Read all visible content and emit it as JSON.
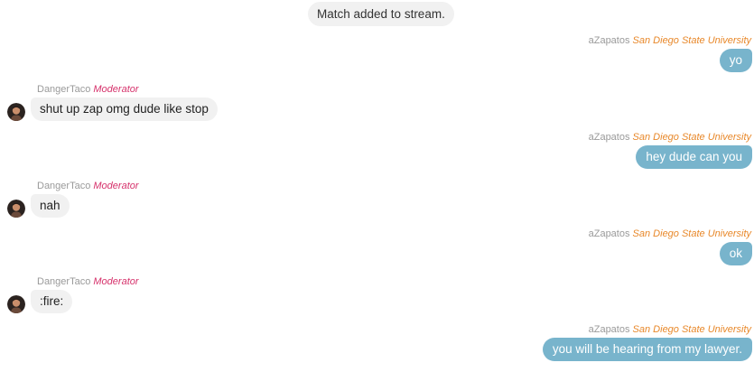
{
  "system_message": "Match added to stream.",
  "messages": [
    {
      "sender": "aZapatos",
      "tag": "San Diego State University",
      "text": "yo"
    },
    {
      "sender": "DangerTaco",
      "tag": "Moderator",
      "text": "shut up zap omg dude like stop"
    },
    {
      "sender": "aZapatos",
      "tag": "San Diego State University",
      "text": "hey dude can you"
    },
    {
      "sender": "DangerTaco",
      "tag": "Moderator",
      "text": "nah"
    },
    {
      "sender": "aZapatos",
      "tag": "San Diego State University",
      "text": "ok"
    },
    {
      "sender": "DangerTaco",
      "tag": "Moderator",
      "text": ":fire:"
    },
    {
      "sender": "aZapatos",
      "tag": "San Diego State University",
      "text": "you will be hearing from my lawyer."
    }
  ],
  "colors": {
    "outgoing_bubble": "#78b4cc",
    "incoming_bubble": "#f1f1f1",
    "affiliation": "#e8882a",
    "moderator": "#d6336c",
    "username": "#9a9a9a"
  },
  "icons": {
    "avatar": "user-avatar-icon"
  }
}
